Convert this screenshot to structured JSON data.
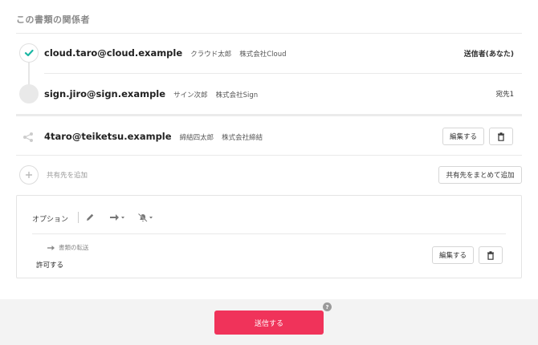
{
  "section_title": "この書類の関係者",
  "participants": [
    {
      "email": "cloud.taro@cloud.example",
      "name": "クラウド太郎",
      "company": "株式会社Cloud",
      "role": "送信者(あなた)"
    },
    {
      "email": "sign.jiro@sign.example",
      "name": "サイン次郎",
      "company": "株式会社Sign",
      "role": "宛先1"
    }
  ],
  "shared": {
    "email": "4taro@teiketsu.example",
    "name": "締結四太郎",
    "company": "株式会社締結",
    "edit_label": "編集する",
    "delete_icon": "trash-icon"
  },
  "add_shared": {
    "label": "共有先を追加",
    "bulk_label": "共有先をまとめて追加"
  },
  "options": {
    "title": "オプション",
    "transfer_label": "書類の転送",
    "transfer_value": "許可する",
    "edit_label": "編集する"
  },
  "footer": {
    "send_label": "送信する",
    "help_glyph": "?"
  },
  "colors": {
    "accent": "#f0335a",
    "check": "#1bb7a4"
  }
}
